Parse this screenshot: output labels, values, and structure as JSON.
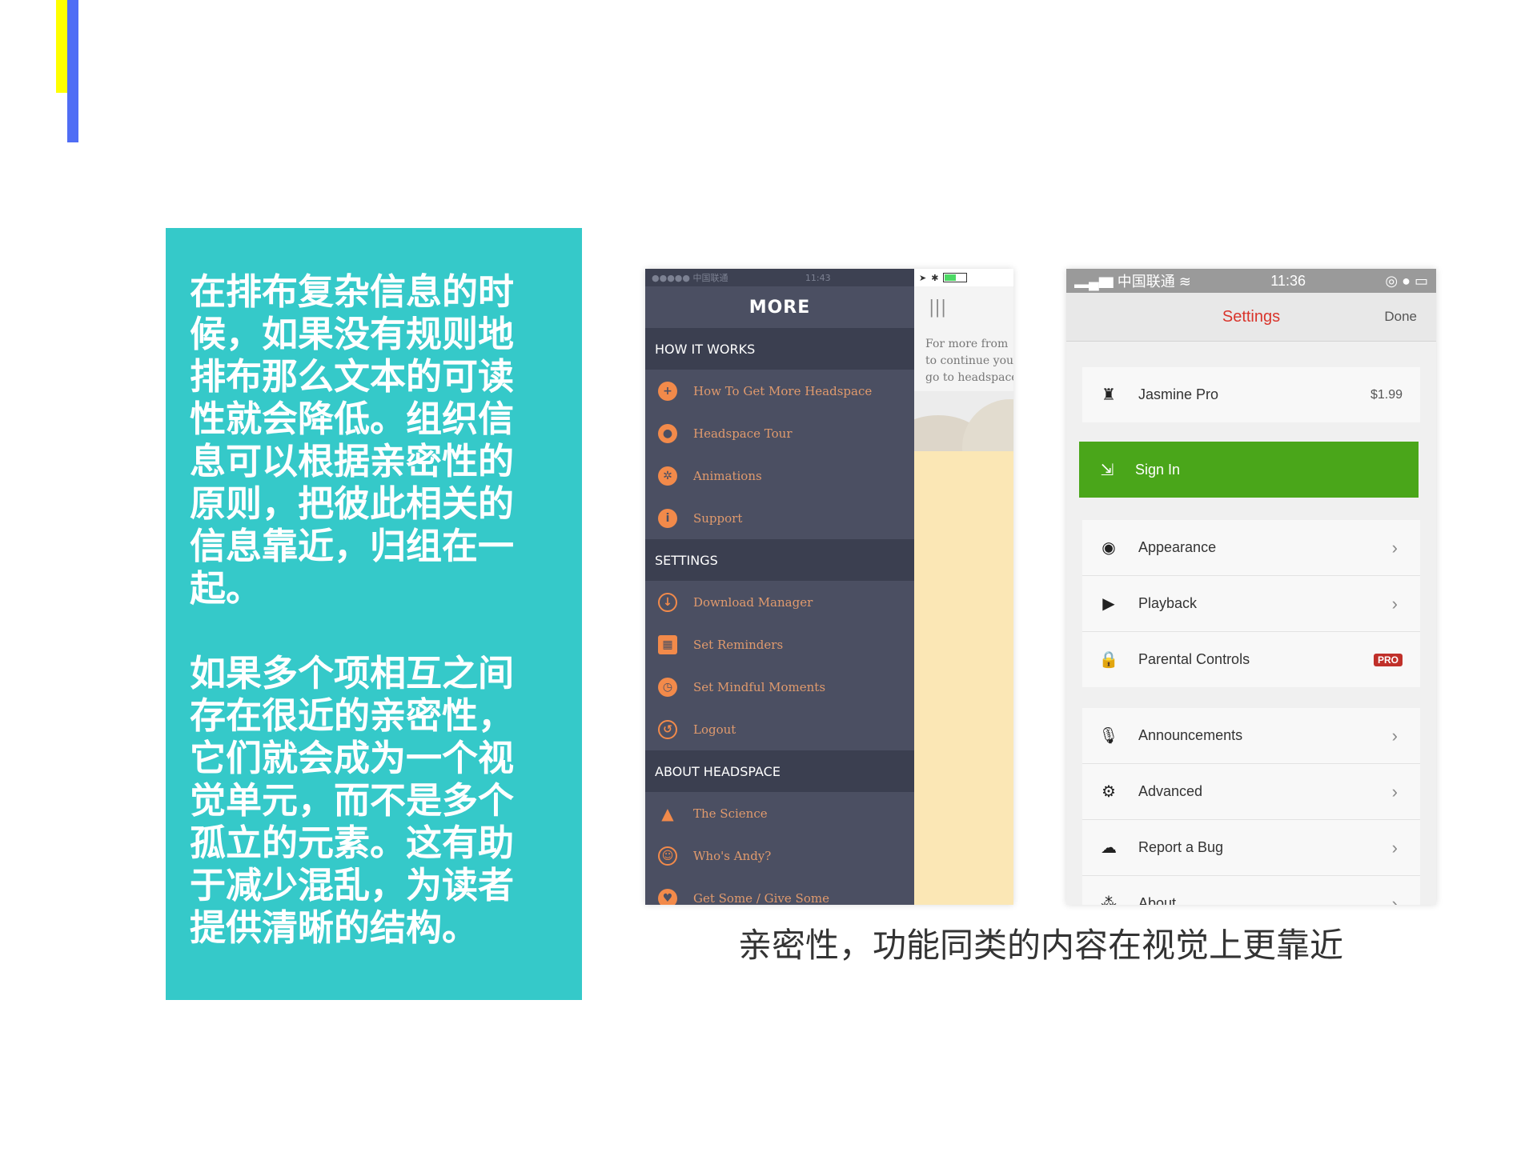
{
  "left_text": {
    "paragraph1": "在排布复杂信息的时候，如果没有规则地排布那么文本的可读性就会降低。组织信息可以根据亲密性的原则，把彼此相关的信息靠近，归组在一起。",
    "paragraph2": "如果多个项相互之间存在很近的亲密性，它们就会成为一个视觉单元，而不是多个孤立的元素。这有助于减少混乱，为读者提供清晰的结构。"
  },
  "phone1": {
    "status_left": "●●●●● 中国联通",
    "status_time": "11:43",
    "title": "MORE",
    "sections": [
      {
        "header": "HOW IT WORKS",
        "items": [
          "How To Get More Headspace",
          "Headspace Tour",
          "Animations",
          "Support"
        ]
      },
      {
        "header": "SETTINGS",
        "items": [
          "Download Manager",
          "Set Reminders",
          "Set Mindful Moments",
          "Logout"
        ]
      },
      {
        "header": "ABOUT HEADSPACE",
        "items": [
          "The Science",
          "Who's Andy?",
          "Get Some / Give Some"
        ]
      }
    ],
    "right_text": [
      "For more from",
      "to continue you",
      "go to headspace"
    ]
  },
  "phone2": {
    "status_carrier": "中国联通",
    "status_time": "11:36",
    "nav_title": "Settings",
    "nav_done": "Done",
    "jasmine_label": "Jasmine Pro",
    "jasmine_price": "$1.99",
    "signin_label": "Sign In",
    "group2": [
      "Appearance",
      "Playback",
      "Parental Controls"
    ],
    "pro_badge": "PRO",
    "group3": [
      "Announcements",
      "Advanced",
      "Report a Bug",
      "About"
    ]
  },
  "caption": "亲密性，功能同类的内容在视觉上更靠近",
  "colors": {
    "teal": "#35c9c9",
    "yellow_bar": "#ffff00",
    "blue_bar": "#4f6df5",
    "headspace_orange": "#f28a4a",
    "settings_green": "#4aa61a",
    "settings_red": "#d9342b"
  }
}
